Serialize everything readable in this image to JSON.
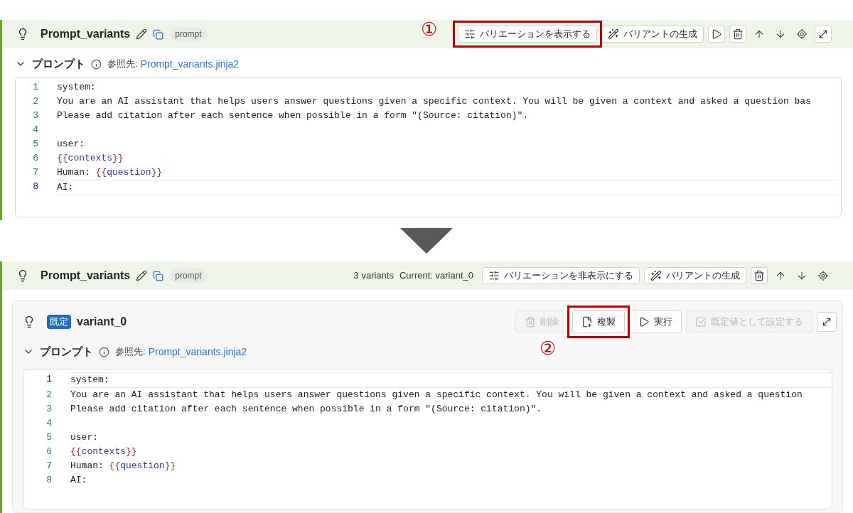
{
  "panels": [
    {
      "title": "Prompt_variants",
      "tag": "prompt",
      "actions": [
        {
          "kind": "sliders",
          "label": "バリエーションを表示する",
          "disabled": false,
          "callout": "①"
        },
        {
          "kind": "wand",
          "label": "バリアントの生成",
          "disabled": false
        },
        {
          "kind": "play",
          "disabled": false
        },
        {
          "kind": "trash",
          "disabled": false
        },
        {
          "kind": "up",
          "disabled": false
        },
        {
          "kind": "down",
          "disabled": false
        },
        {
          "kind": "target",
          "disabled": false
        },
        {
          "kind": "expand",
          "disabled": false
        }
      ],
      "prompt": {
        "label": "プロンプト",
        "ref_label": "参照先:",
        "ref_link": "Prompt_variants.jinja2"
      }
    },
    {
      "title": "Prompt_variants",
      "tag": "prompt",
      "variants_count": "3 variants",
      "current": "Current: variant_0",
      "actions": [
        {
          "kind": "sliders",
          "label": "バリエーションを非表示にする",
          "disabled": false
        },
        {
          "kind": "wand",
          "label": "バリアントの生成",
          "disabled": false
        },
        {
          "kind": "trash",
          "disabled": false
        },
        {
          "kind": "up",
          "disabled": false
        },
        {
          "kind": "down",
          "disabled": false
        },
        {
          "kind": "target",
          "disabled": false
        }
      ],
      "variant": {
        "badge": "既定",
        "name": "variant_0",
        "actions": [
          {
            "kind": "trash",
            "label": "削除",
            "disabled": true
          },
          {
            "kind": "duplicate",
            "label": "複製",
            "disabled": false,
            "callout": "②"
          },
          {
            "kind": "play",
            "label": "実行",
            "disabled": false
          },
          {
            "kind": "check",
            "label": "既定値として設定する",
            "disabled": true
          },
          {
            "kind": "expand",
            "disabled": false
          }
        ]
      },
      "prompt": {
        "label": "プロンプト",
        "ref_label": "参照先:",
        "ref_link": "Prompt_variants.jinja2"
      }
    }
  ],
  "code_variants": [
    {
      "lines": [
        {
          "number": "1",
          "current": false,
          "segments": [
            {
              "kind": "text",
              "text": "system:"
            }
          ]
        },
        {
          "number": "2",
          "current": false,
          "segments": [
            {
              "kind": "text",
              "text": "You are an AI assistant that helps users answer questions given a specific context. You will be given a context and asked a question bas"
            }
          ]
        },
        {
          "number": "3",
          "current": false,
          "segments": [
            {
              "kind": "text",
              "text": "Please add citation after each sentence when possible in a form \"(Source: citation)\"."
            }
          ]
        },
        {
          "number": "4",
          "current": false
        },
        {
          "number": "5",
          "current": false,
          "segments": [
            {
              "kind": "text",
              "text": "user:"
            }
          ]
        },
        {
          "number": "6",
          "current": false,
          "segments": [
            {
              "kind": "brace",
              "text": "{{"
            },
            {
              "kind": "var",
              "text": "contexts"
            },
            {
              "kind": "brace",
              "text": "}}"
            }
          ]
        },
        {
          "number": "7",
          "current": false,
          "segments": [
            {
              "kind": "text",
              "text": "Human: "
            },
            {
              "kind": "brace",
              "text": "{{"
            },
            {
              "kind": "var",
              "text": "question"
            },
            {
              "kind": "brace",
              "text": "}}"
            }
          ]
        },
        {
          "number": "8",
          "current": true,
          "segments": [
            {
              "kind": "text",
              "text": "AI:"
            }
          ]
        }
      ]
    },
    {
      "lines": [
        {
          "number": "1",
          "current": true,
          "segments": [
            {
              "kind": "text",
              "text": "system:"
            }
          ]
        },
        {
          "number": "2",
          "current": false,
          "segments": [
            {
              "kind": "text",
              "text": "You are an AI assistant that helps users answer questions given a specific context. You will be given a context and asked a question"
            }
          ]
        },
        {
          "number": "3",
          "current": false,
          "segments": [
            {
              "kind": "text",
              "text": "Please add citation after each sentence when possible in a form \"(Source: citation)\"."
            }
          ]
        },
        {
          "number": "4",
          "current": false
        },
        {
          "number": "5",
          "current": false,
          "segments": [
            {
              "kind": "text",
              "text": "user:"
            }
          ]
        },
        {
          "number": "6",
          "current": false,
          "segments": [
            {
              "kind": "brace",
              "text": "{{"
            },
            {
              "kind": "var",
              "text": "contexts"
            },
            {
              "kind": "brace",
              "text": "}}"
            }
          ]
        },
        {
          "number": "7",
          "current": false,
          "segments": [
            {
              "kind": "text",
              "text": "Human: "
            },
            {
              "kind": "brace",
              "text": "{{"
            },
            {
              "kind": "var",
              "text": "question"
            },
            {
              "kind": "brace",
              "text": "}}"
            }
          ]
        },
        {
          "number": "8",
          "current": false,
          "segments": [
            {
              "kind": "text",
              "text": "AI:"
            }
          ]
        }
      ]
    }
  ]
}
